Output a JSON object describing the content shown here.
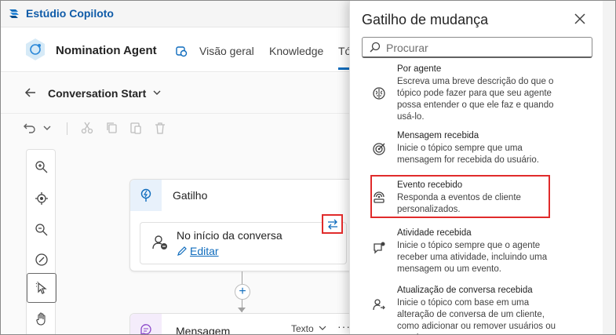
{
  "app": {
    "title": "Estúdio Copiloto",
    "brand_color": "#0f5ba8"
  },
  "agent": {
    "name": "Nomination Agent",
    "tabs": [
      {
        "label": "Visão geral"
      },
      {
        "label": "Knowledge"
      },
      {
        "label": "Tó"
      }
    ]
  },
  "topic": {
    "name": "Conversation Start"
  },
  "canvas": {
    "trigger_node": {
      "title": "Gatilho",
      "inner_title": "No início da conversa",
      "edit_link": "Editar"
    },
    "message_node": {
      "title": "Mensagem",
      "type_label": "Texto",
      "more": "···"
    },
    "add_symbol": "+",
    "ghost_button": "e"
  },
  "panel": {
    "title": "Gatilho de mudança",
    "search_placeholder": "Procurar",
    "items": [
      {
        "title": "Por agente",
        "desc": "Escreva uma breve descrição do que o tópico pode fazer para que seu agente possa entender o que ele faz e quando usá-lo.",
        "icon": "brain-icon"
      },
      {
        "title": "Mensagem recebida",
        "desc": "Inicie o tópico sempre que uma mensagem for recebida do usuário.",
        "icon": "target-icon"
      },
      {
        "title": "Evento recebido",
        "desc": "Responda a eventos de cliente personalizados.",
        "icon": "broadcast-icon"
      },
      {
        "title": "Atividade recebida",
        "desc": "Inicie o tópico sempre que o agente receber uma atividade, incluindo uma mensagem ou um evento.",
        "icon": "chat-activity-icon"
      },
      {
        "title": "Atualização de conversa recebida",
        "desc": "Inicie o tópico com base em uma alteração de conversa de um cliente, como adicionar ou remover usuários ou canais.",
        "icon": "people-update-icon"
      }
    ]
  },
  "colors": {
    "accent": "#0f6cbd",
    "highlight": "#e02b2b"
  }
}
